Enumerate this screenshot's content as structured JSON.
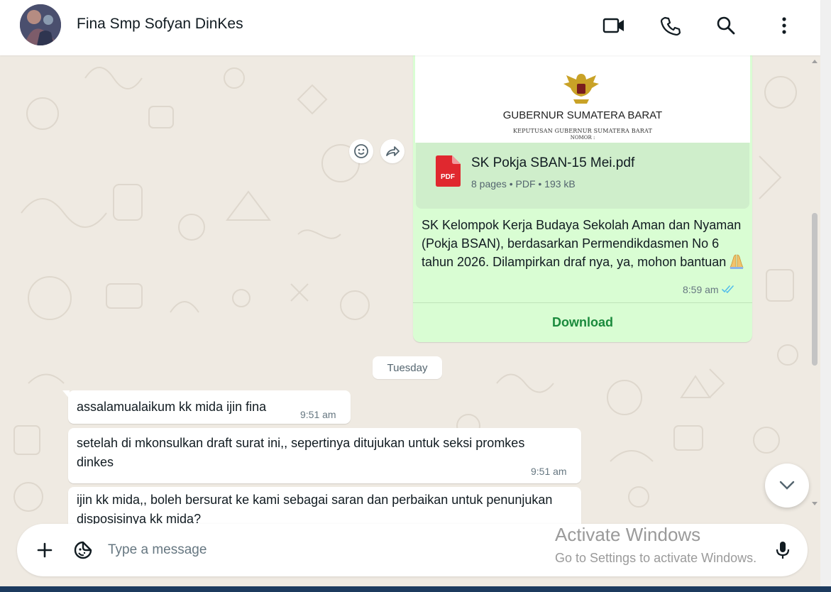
{
  "header": {
    "contact_name": "Fina Smp Sofyan DinKes",
    "icons": [
      "video-call-icon",
      "voice-call-icon",
      "search-icon",
      "menu-icon"
    ]
  },
  "document_message": {
    "preview": {
      "heading": "GUBERNUR SUMATERA BARAT",
      "subheading": "KEPUTUSAN GUBERNUR SUMATERA BARAT",
      "subheading2": "NOMOR :"
    },
    "file_name": "SK Pokja SBAN-15 Mei.pdf",
    "file_meta": "8 pages • PDF • 193 kB",
    "file_type_label": "PDF",
    "caption": "SK Kelompok Kerja Budaya Sekolah Aman dan Nyaman (Pokja BSAN), berdasarkan Permendikdasmen No 6 tahun 2026. Dilampirkan draf nya, ya, mohon bantuan",
    "time": "8:59 am",
    "status": "read",
    "download_label": "Download"
  },
  "date_separator": "Tuesday",
  "incoming_messages": [
    {
      "text": "assalamualaikum kk mida ijin fina",
      "time": "9:51 am"
    },
    {
      "text": "setelah di mkonsulkan draft surat ini,, sepertinya ditujukan untuk seksi promkes  dinkes",
      "time": "9:51 am"
    },
    {
      "text": "ijin kk mida,, boleh bersurat ke kami sebagai saran dan perbaikan untuk penunjukan disposisinya kk mida?",
      "time": ""
    }
  ],
  "composer": {
    "placeholder": "Type a message",
    "value": ""
  },
  "watermark": {
    "title": "Activate Windows",
    "subtitle": "Go to Settings to activate Windows."
  },
  "colors": {
    "outgoing_bubble": "#d9fdd3",
    "incoming_bubble": "#ffffff",
    "background": "#efeae2",
    "download_green": "#1a8a3c",
    "read_tick_blue": "#53bdeb",
    "pdf_red": "#e0282f"
  }
}
